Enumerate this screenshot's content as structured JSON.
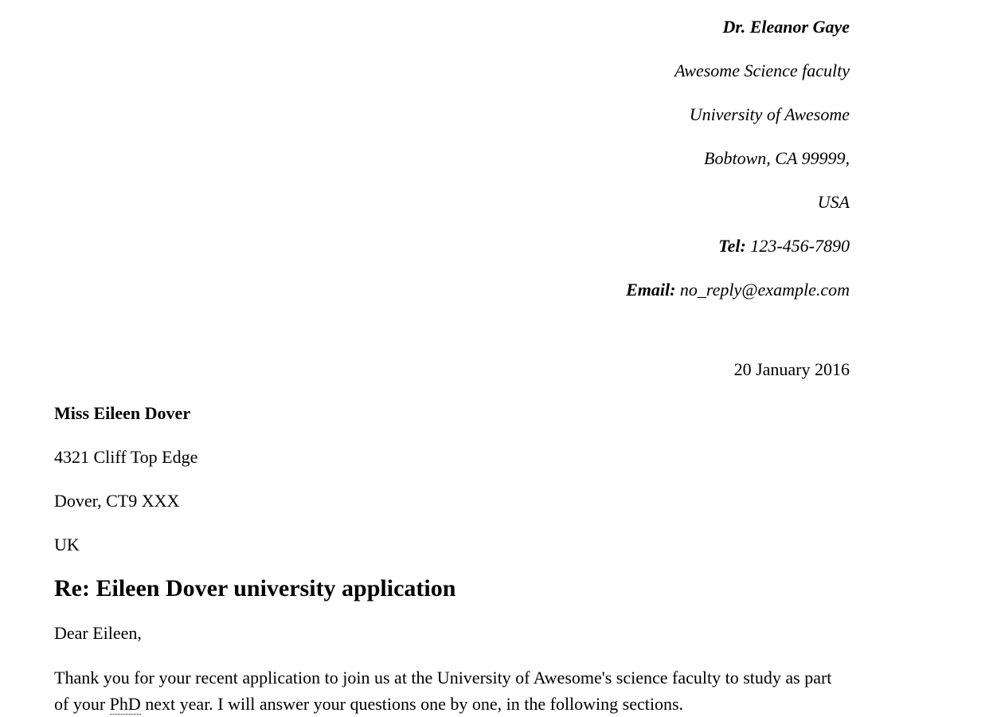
{
  "sender": {
    "name": "Dr. Eleanor Gaye",
    "faculty": "Awesome Science faculty",
    "university": "University of Awesome",
    "city": "Bobtown, CA 99999,",
    "country": "USA",
    "tel_label": "Tel:",
    "tel_value": "123-456-7890",
    "email_label": "Email:",
    "email_value": "no_reply@example.com"
  },
  "date": "20 January 2016",
  "recipient": {
    "name": "Miss Eileen Dover",
    "street": "4321 Cliff Top Edge",
    "city": "Dover, CT9 XXX",
    "country": "UK"
  },
  "subject": "Re: Eileen Dover university application",
  "salutation": "Dear Eileen,",
  "body": {
    "para1_before": "Thank you for your recent application to join us at the University of Awesome's science faculty to study as part of your ",
    "para1_abbr": "PhD",
    "para1_after": " next year. I will answer your questions one by one, in the following sections."
  }
}
